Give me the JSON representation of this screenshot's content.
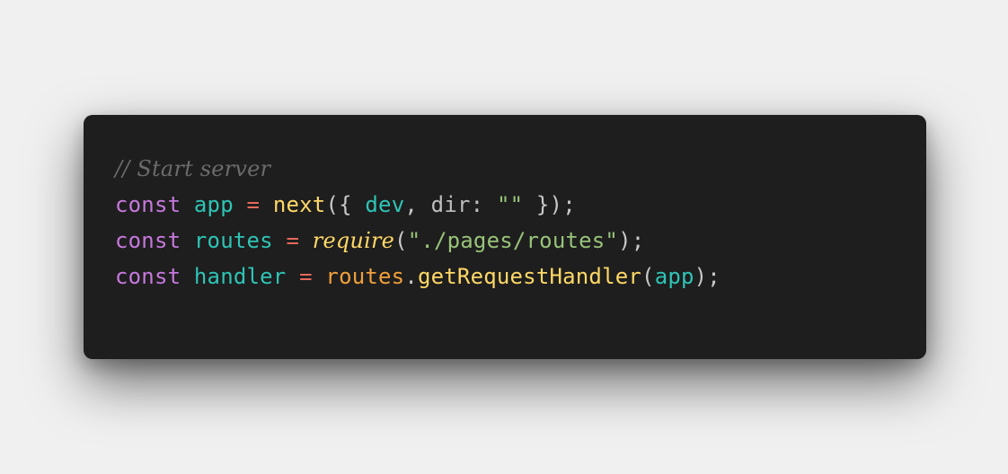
{
  "code": {
    "line1": {
      "comment": "// Start server"
    },
    "line2": {
      "kw": "const",
      "name": "app",
      "eq": "=",
      "fn": "next",
      "open": "({",
      "arg1": "dev",
      "comma": ",",
      "prop": "dir:",
      "str": "\"\"",
      "close": "});"
    },
    "line3": {
      "kw": "const",
      "name": "routes",
      "eq": "=",
      "fn": "require",
      "open": "(",
      "str": "\"./pages/routes\"",
      "close": ");"
    },
    "line4": {
      "kw": "const",
      "name": "handler",
      "eq": "=",
      "obj": "routes",
      "dot": ".",
      "method": "getRequestHandler",
      "open": "(",
      "arg": "app",
      "close": ");"
    }
  },
  "colors": {
    "background": "#f0f0f0",
    "editor": "#1e1e1e",
    "comment": "#6b6b6b",
    "keyword": "#c678dd",
    "variable": "#2ec4b6",
    "operator": "#e8695a",
    "function": "#ffd866",
    "string": "#98c379",
    "object": "#f0a03c"
  }
}
